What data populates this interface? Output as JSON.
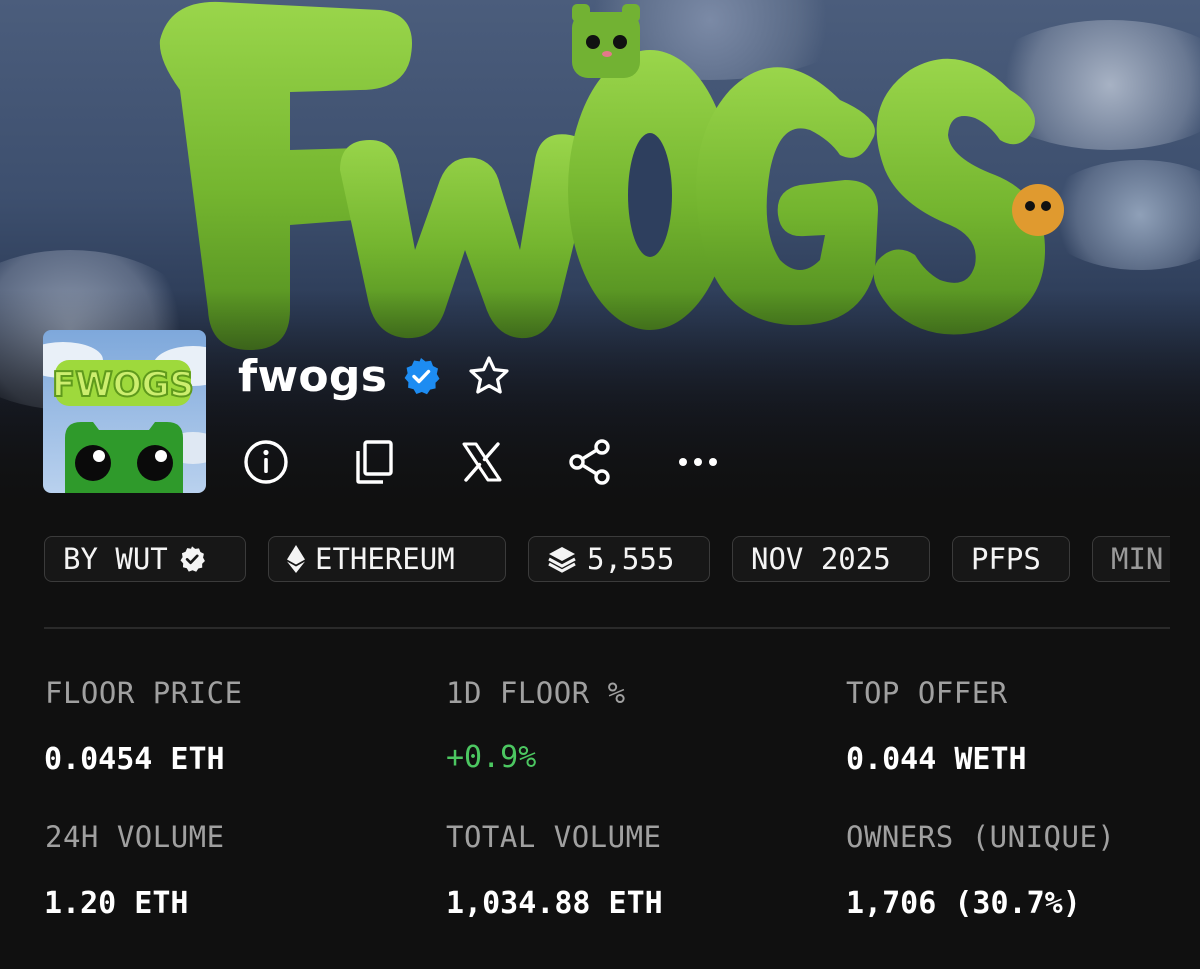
{
  "collection": {
    "name": "fwogs",
    "banner_logo_text": "FWOGS",
    "avatar_logo_text": "FWOGS",
    "verified": true
  },
  "actions": {
    "icons": [
      "info-icon",
      "copy-icon",
      "x-logo-icon",
      "share-icon",
      "more-icon",
      "star-icon"
    ]
  },
  "tags": [
    {
      "label": "BY WUT",
      "icon": "verified-icon"
    },
    {
      "label": "ETHEREUM",
      "icon": "ethereum-icon"
    },
    {
      "label": "5,555",
      "icon": "layers-icon"
    },
    {
      "label": "NOV 2025"
    },
    {
      "label": "PFPS"
    },
    {
      "label": "MIN"
    }
  ],
  "stats": [
    {
      "label": "FLOOR PRICE",
      "value": "0.0454 ETH"
    },
    {
      "label": "1D FLOOR %",
      "value": "+0.9%",
      "positive": true
    },
    {
      "label": "TOP OFFER",
      "value": "0.044 WETH"
    },
    {
      "label": "24H VOLUME",
      "value": "1.20 ETH"
    },
    {
      "label": "TOTAL VOLUME",
      "value": "1,034.88 ETH"
    },
    {
      "label": "OWNERS (UNIQUE)",
      "value": "1,706 (30.7%)"
    }
  ],
  "colors": {
    "background": "#101010",
    "accent_green": "#4cc761",
    "verified_blue": "#1d8cf2",
    "frog_green": "#7cc23a"
  }
}
